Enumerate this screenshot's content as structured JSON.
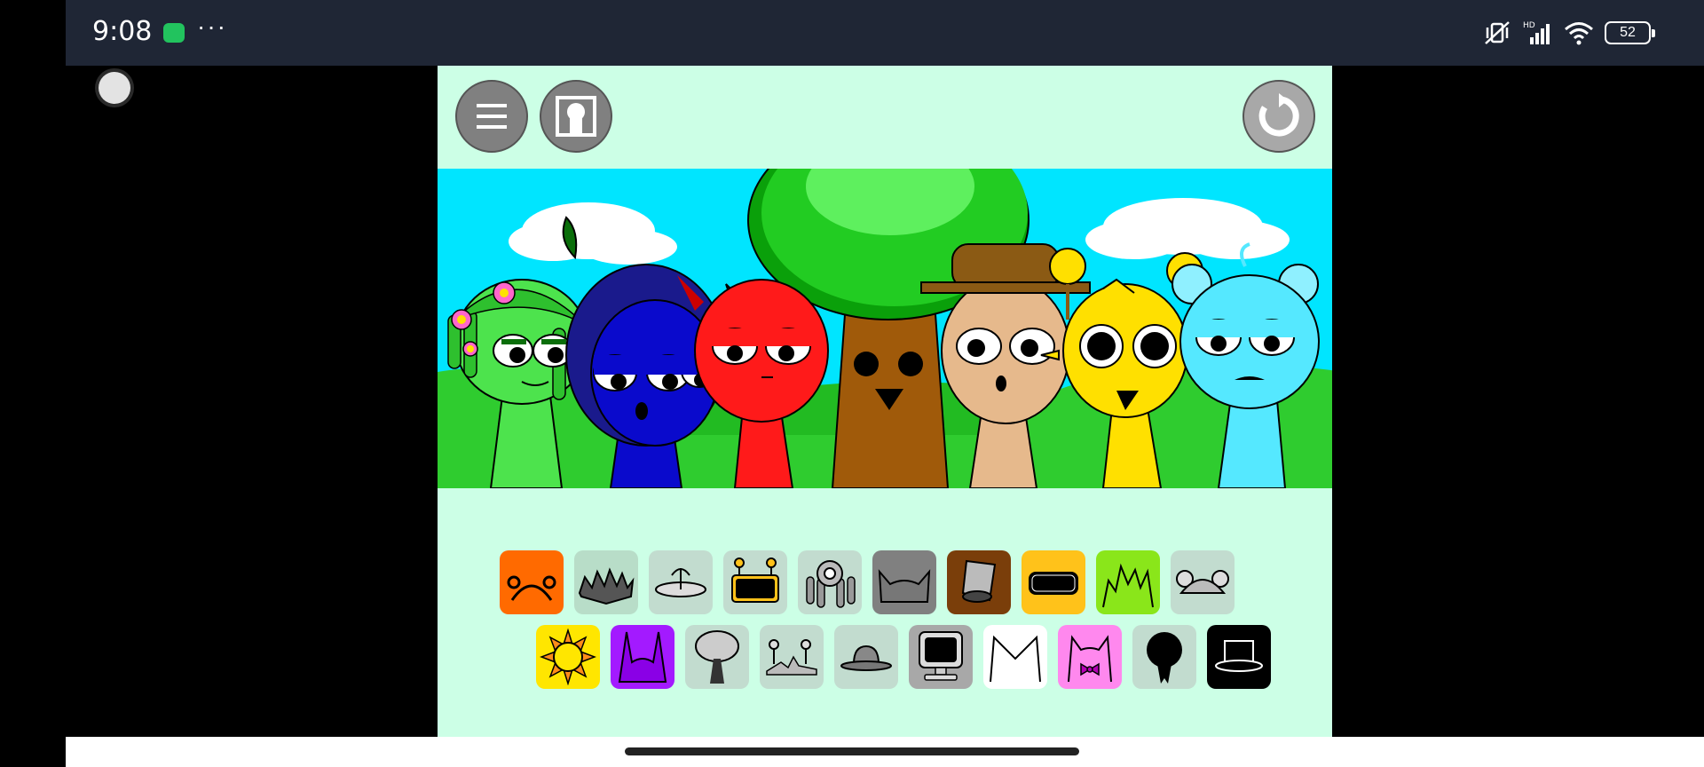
{
  "status_bar": {
    "time": "9:08",
    "more": "···",
    "battery": "52"
  },
  "toolbar": {
    "menu_icon": "menu-icon",
    "profile_icon": "profile-icon",
    "reset_icon": "reset-icon"
  },
  "characters": [
    {
      "name": "flower-dreadlocks-character",
      "color": "#4de34d"
    },
    {
      "name": "blue-hooded-character",
      "color": "#0a0acc"
    },
    {
      "name": "red-horned-character",
      "color": "#ff1a1a"
    },
    {
      "name": "tree-character",
      "color": "#a05a0a"
    },
    {
      "name": "tan-hat-character",
      "color": "#e6b98c"
    },
    {
      "name": "yellow-character",
      "color": "#ffe000"
    },
    {
      "name": "light-blue-bear-character",
      "color": "#55e8ff"
    }
  ],
  "accessories_row1": [
    {
      "name": "orange-antenna-icon",
      "bg": "#ff6a00"
    },
    {
      "name": "spiky-hair-icon",
      "bg": "#b8ddc8"
    },
    {
      "name": "disc-hat-icon",
      "bg": "#c2dccf"
    },
    {
      "name": "robot-head-icon",
      "bg": "#c2dccf"
    },
    {
      "name": "flower-hair-icon",
      "bg": "#c2dccf"
    },
    {
      "name": "cat-ears-icon",
      "bg": "#808080"
    },
    {
      "name": "bucket-hat-icon",
      "bg": "#7a3e0a"
    },
    {
      "name": "visor-icon",
      "bg": "#ffc21a"
    },
    {
      "name": "green-spikes-icon",
      "bg": "#8ae61a"
    },
    {
      "name": "mouse-ears-icon",
      "bg": "#c2dccf"
    }
  ],
  "accessories_row2": [
    {
      "name": "sun-icon",
      "bg": "#ffe600"
    },
    {
      "name": "purple-horns-icon",
      "bg": "#a31aff"
    },
    {
      "name": "mushroom-icon",
      "bg": "#c2dccf"
    },
    {
      "name": "antenna-hair-icon",
      "bg": "#c2dccf"
    },
    {
      "name": "bowler-hat-icon",
      "bg": "#c2dccf"
    },
    {
      "name": "computer-monitor-icon",
      "bg": "#a8a8a8"
    },
    {
      "name": "white-cat-ears-icon",
      "bg": "#ffffff"
    },
    {
      "name": "pink-bow-icon",
      "bg": "#ff88ee"
    },
    {
      "name": "black-balloon-icon",
      "bg": "#c2dccf"
    },
    {
      "name": "black-top-hat-icon",
      "bg": "#000000"
    }
  ]
}
